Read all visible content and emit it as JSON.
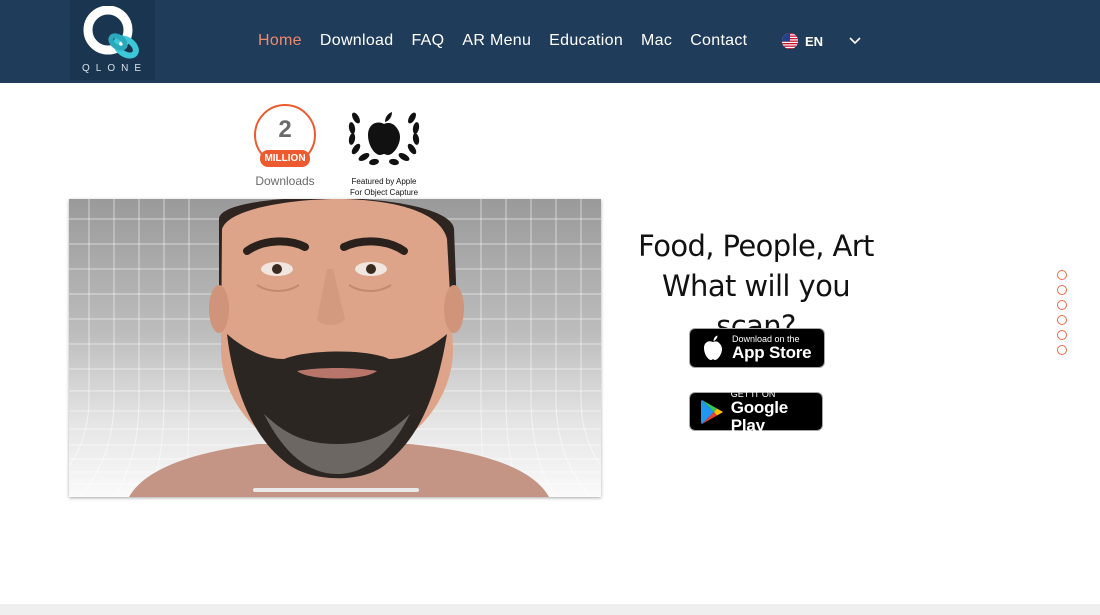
{
  "brand": {
    "logo_text": "QLONE"
  },
  "nav": {
    "items": [
      {
        "label": "Home",
        "active": true
      },
      {
        "label": "Download",
        "active": false
      },
      {
        "label": "FAQ",
        "active": false
      },
      {
        "label": "AR Menu",
        "active": false
      },
      {
        "label": "Education",
        "active": false
      },
      {
        "label": "Mac",
        "active": false
      },
      {
        "label": "Contact",
        "active": false
      }
    ],
    "language": "EN"
  },
  "badges": {
    "downloads_number": "2",
    "downloads_ribbon": "MILLION",
    "downloads_caption": "Downloads",
    "apple_line1": "Featured by Apple",
    "apple_line2": "For Object Capture"
  },
  "headline": {
    "line1": "Food, People, Art",
    "line2": "What will you scan?"
  },
  "stores": {
    "appstore_small": "Download on the",
    "appstore_big": "App Store",
    "gplay_small": "GET IT ON",
    "gplay_big": "Google Play"
  },
  "colors": {
    "header_bg": "#1f3c5a",
    "accent": "#ee5a2f",
    "nav_active": "#f08a6c",
    "logo_ring": "#3cc8d8"
  },
  "section_dots": 6
}
